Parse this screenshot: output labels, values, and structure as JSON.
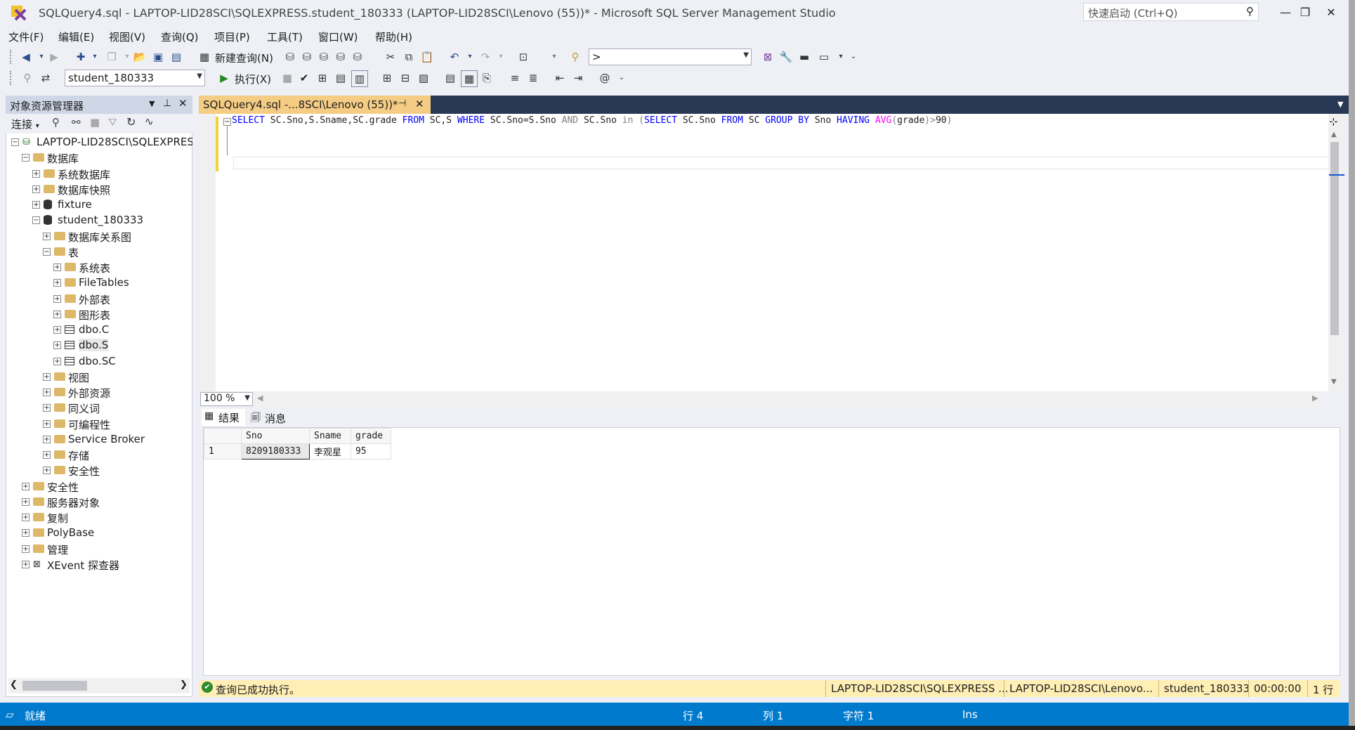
{
  "window": {
    "title": "SQLQuery4.sql - LAPTOP-LID28SCI\\SQLEXPRESS.student_180333 (LAPTOP-LID28SCI\\Lenovo (55))* - Microsoft SQL Server Management Studio",
    "quick_launch_placeholder": "快速启动 (Ctrl+Q)",
    "minimize": "—",
    "maximize": "❐",
    "close": "✕"
  },
  "menu": [
    "文件(F)",
    "编辑(E)",
    "视图(V)",
    "查询(Q)",
    "项目(P)",
    "工具(T)",
    "窗口(W)",
    "帮助(H)"
  ],
  "toolbar1": {
    "new_query": "新建查询(N)",
    "search_combo": ">"
  },
  "toolbar2": {
    "database": "student_180333",
    "execute": "执行(X)"
  },
  "object_explorer": {
    "title": "对象资源管理器",
    "connect": "连接",
    "tree": [
      {
        "label": "LAPTOP-LID28SCI\\SQLEXPRESS",
        "level": 0,
        "icon": "server",
        "exp": "−"
      },
      {
        "label": "数据库",
        "level": 1,
        "icon": "folder",
        "exp": "−"
      },
      {
        "label": "系统数据库",
        "level": 2,
        "icon": "folder",
        "exp": "+"
      },
      {
        "label": "数据库快照",
        "level": 2,
        "icon": "folder",
        "exp": "+"
      },
      {
        "label": "fixture",
        "level": 2,
        "icon": "db",
        "exp": "+"
      },
      {
        "label": "student_180333",
        "level": 2,
        "icon": "db",
        "exp": "−"
      },
      {
        "label": "数据库关系图",
        "level": 3,
        "icon": "folder",
        "exp": "+"
      },
      {
        "label": "表",
        "level": 3,
        "icon": "folder",
        "exp": "−"
      },
      {
        "label": "系统表",
        "level": 4,
        "icon": "folder",
        "exp": "+"
      },
      {
        "label": "FileTables",
        "level": 4,
        "icon": "folder",
        "exp": "+"
      },
      {
        "label": "外部表",
        "level": 4,
        "icon": "folder",
        "exp": "+"
      },
      {
        "label": "图形表",
        "level": 4,
        "icon": "folder",
        "exp": "+"
      },
      {
        "label": "dbo.C",
        "level": 4,
        "icon": "table",
        "exp": "+"
      },
      {
        "label": "dbo.S",
        "level": 4,
        "icon": "table",
        "exp": "+"
      },
      {
        "label": "dbo.SC",
        "level": 4,
        "icon": "table",
        "exp": "+"
      },
      {
        "label": "视图",
        "level": 3,
        "icon": "folder",
        "exp": "+"
      },
      {
        "label": "外部资源",
        "level": 3,
        "icon": "folder",
        "exp": "+"
      },
      {
        "label": "同义词",
        "level": 3,
        "icon": "folder",
        "exp": "+"
      },
      {
        "label": "可编程性",
        "level": 3,
        "icon": "folder",
        "exp": "+"
      },
      {
        "label": "Service Broker",
        "level": 3,
        "icon": "folder",
        "exp": "+"
      },
      {
        "label": "存储",
        "level": 3,
        "icon": "folder",
        "exp": "+"
      },
      {
        "label": "安全性",
        "level": 3,
        "icon": "folder",
        "exp": "+"
      },
      {
        "label": "安全性",
        "level": 1,
        "icon": "folder",
        "exp": "+"
      },
      {
        "label": "服务器对象",
        "level": 1,
        "icon": "folder",
        "exp": "+"
      },
      {
        "label": "复制",
        "level": 1,
        "icon": "folder",
        "exp": "+"
      },
      {
        "label": "PolyBase",
        "level": 1,
        "icon": "folder",
        "exp": "+"
      },
      {
        "label": "管理",
        "level": 1,
        "icon": "folder",
        "exp": "+"
      },
      {
        "label": "XEvent 探查器",
        "level": 1,
        "icon": "xevent",
        "exp": "+"
      }
    ]
  },
  "editor": {
    "tab_label": "SQLQuery4.sql -...8SCI\\Lenovo (55))*",
    "sql_tokens": [
      {
        "t": "SELECT",
        "c": "kw"
      },
      {
        "t": " SC.Sno,S.Sname,SC.grade ",
        "c": "blk"
      },
      {
        "t": "FROM",
        "c": "kw"
      },
      {
        "t": " SC,S ",
        "c": "blk"
      },
      {
        "t": "WHERE",
        "c": "kw"
      },
      {
        "t": " SC.Sno=S.Sno ",
        "c": "blk"
      },
      {
        "t": "AND",
        "c": "gray"
      },
      {
        "t": " SC.Sno ",
        "c": "blk"
      },
      {
        "t": "in",
        "c": "gray"
      },
      {
        "t": " (",
        "c": "gray"
      },
      {
        "t": "SELECT",
        "c": "kw"
      },
      {
        "t": " SC.Sno ",
        "c": "blk"
      },
      {
        "t": "FROM",
        "c": "kw"
      },
      {
        "t": " SC ",
        "c": "blk"
      },
      {
        "t": "GROUP BY",
        "c": "kw"
      },
      {
        "t": " Sno ",
        "c": "blk"
      },
      {
        "t": "HAVING",
        "c": "kw"
      },
      {
        "t": " ",
        "c": "blk"
      },
      {
        "t": "AVG",
        "c": "fn"
      },
      {
        "t": "(",
        "c": "gray"
      },
      {
        "t": "grade",
        "c": "blk"
      },
      {
        "t": ")>",
        "c": "gray"
      },
      {
        "t": "90",
        "c": "blk"
      },
      {
        "t": ")",
        "c": "gray"
      }
    ],
    "zoom": "100 %"
  },
  "results": {
    "tab_results": "结果",
    "tab_messages": "消息",
    "columns": [
      "Sno",
      "Sname",
      "grade"
    ],
    "rows": [
      {
        "num": "1",
        "cells": [
          "8209180333",
          "李观星",
          "95"
        ]
      }
    ]
  },
  "query_status": {
    "message": "查询已成功执行。",
    "server": "LAPTOP-LID28SCI\\SQLEXPRESS ...",
    "user": "LAPTOP-LID28SCI\\Lenovo...",
    "database": "student_180333",
    "elapsed": "00:00:00",
    "rows": "1 行"
  },
  "statusbar": {
    "ready": "就绪",
    "line": "行 4",
    "col": "列 1",
    "char": "字符 1",
    "ins": "Ins"
  }
}
